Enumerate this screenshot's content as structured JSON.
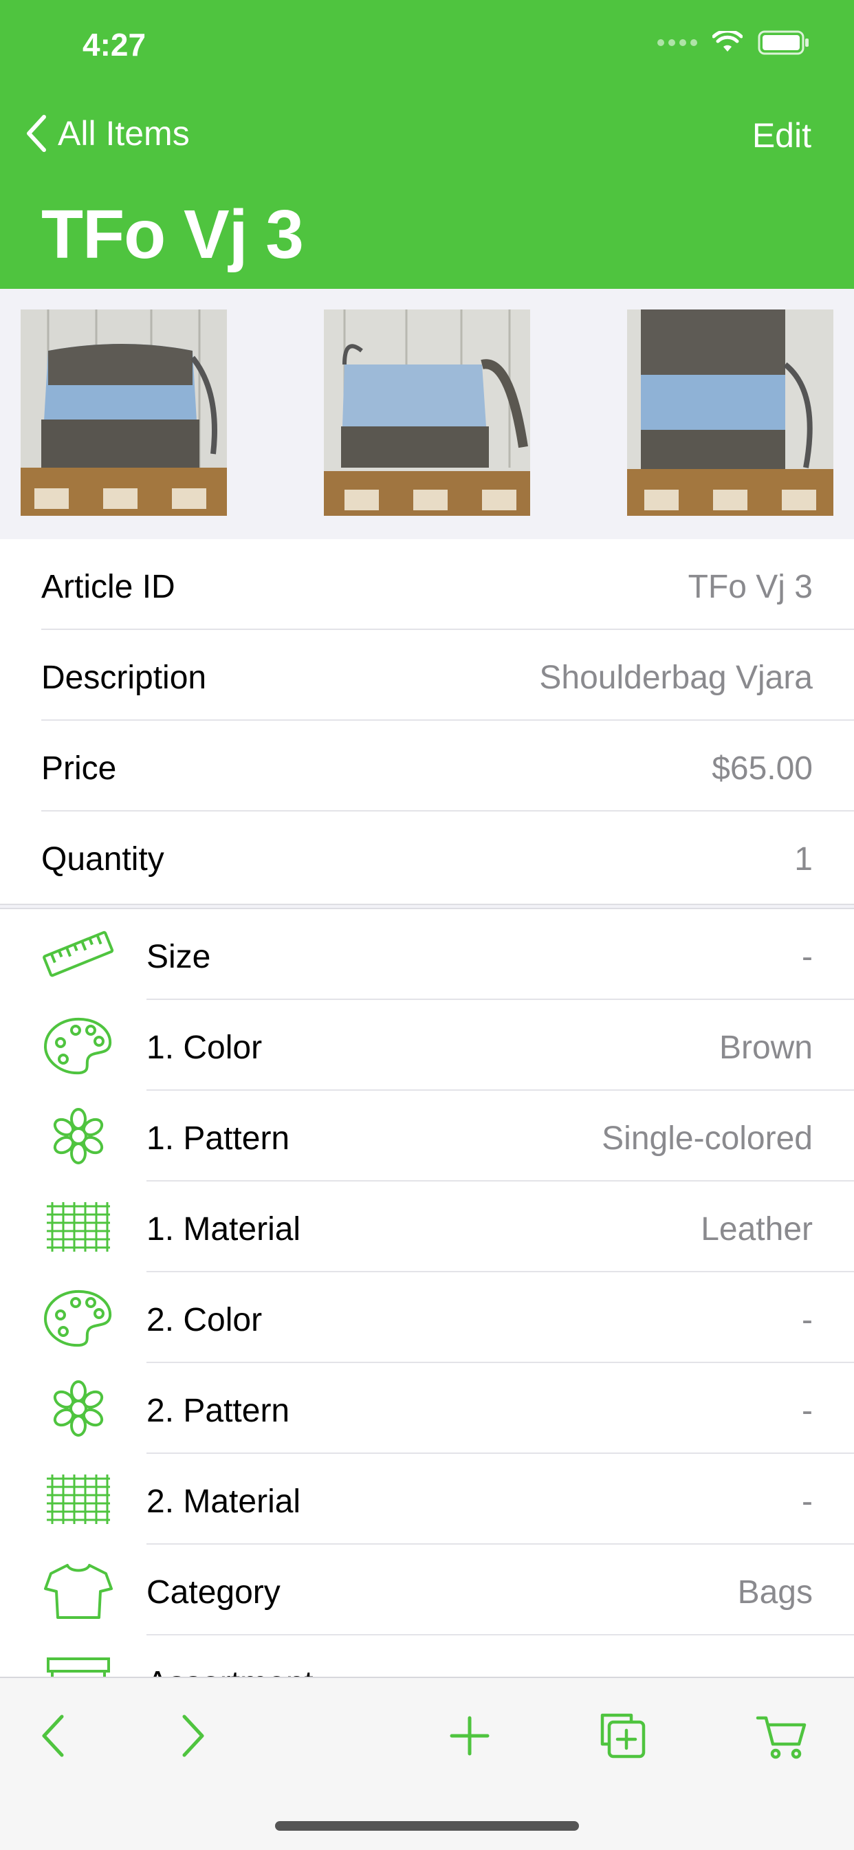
{
  "status": {
    "time": "4:27"
  },
  "nav": {
    "back_label": "All Items",
    "edit_label": "Edit",
    "title": "TFo Vj 3"
  },
  "photos": [
    {
      "name": "bag-photo-1"
    },
    {
      "name": "bag-photo-2"
    },
    {
      "name": "bag-photo-3"
    }
  ],
  "details": [
    {
      "label": "Article ID",
      "value": "TFo Vj 3"
    },
    {
      "label": "Description",
      "value": "Shoulderbag Vjara"
    },
    {
      "label": "Price",
      "value": "$65.00"
    },
    {
      "label": "Quantity",
      "value": "1"
    }
  ],
  "attributes": [
    {
      "icon": "ruler-icon",
      "label": "Size",
      "value": "-"
    },
    {
      "icon": "palette-icon",
      "label": "1. Color",
      "value": "Brown"
    },
    {
      "icon": "flower-icon",
      "label": "1. Pattern",
      "value": "Single-colored"
    },
    {
      "icon": "fabric-icon",
      "label": "1. Material",
      "value": "Leather"
    },
    {
      "icon": "palette-icon",
      "label": "2. Color",
      "value": "-"
    },
    {
      "icon": "flower-icon",
      "label": "2. Pattern",
      "value": "-"
    },
    {
      "icon": "fabric-icon",
      "label": "2. Material",
      "value": "-"
    },
    {
      "icon": "tshirt-icon",
      "label": "Category",
      "value": "Bags"
    },
    {
      "icon": "archive-box-icon",
      "label": "Assortment",
      "value": ""
    }
  ],
  "toolbar": {
    "items": [
      "chevron-left-icon",
      "chevron-right-icon",
      "plus-icon",
      "duplicate-icon",
      "cart-icon"
    ]
  },
  "colors": {
    "accent": "#4fc43f",
    "secondary_text": "#8a8a8e",
    "background": "#f2f2f7"
  }
}
